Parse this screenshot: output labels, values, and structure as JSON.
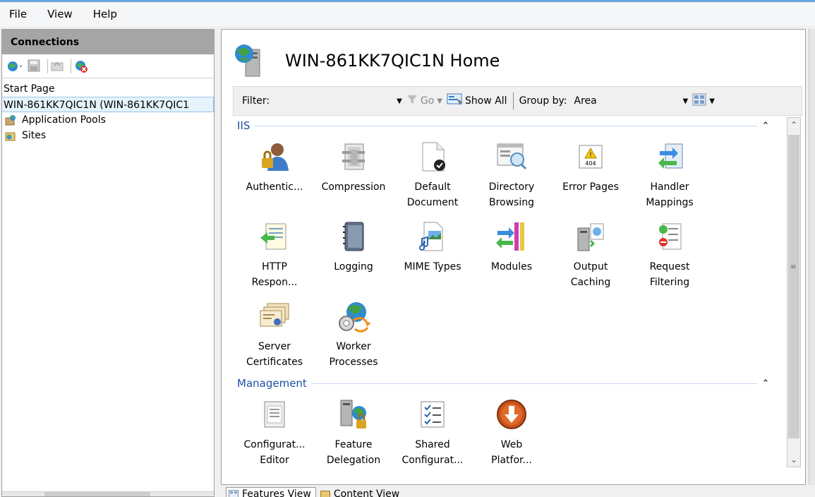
{
  "menu": [
    "File",
    "View",
    "Help"
  ],
  "connections": {
    "title": "Connections",
    "tree": {
      "start_page": "Start Page",
      "server": "WIN-861KK7QIC1N (WIN-861KK7QIC1",
      "children": [
        "Application Pools",
        "Sites"
      ]
    }
  },
  "main": {
    "title": "WIN-861KK7QIC1N Home",
    "filter": {
      "label": "Filter:",
      "value": "",
      "go": "Go",
      "show_all": "Show All",
      "group_by_label": "Group by:",
      "group_by_value": "Area"
    },
    "groups": [
      {
        "name": "IIS",
        "items": [
          {
            "label": "Authentic...",
            "icon": "authentication-icon"
          },
          {
            "label": "Compression",
            "icon": "compression-icon"
          },
          {
            "label": "Default\nDocument",
            "icon": "default-document-icon"
          },
          {
            "label": "Directory\nBrowsing",
            "icon": "directory-browsing-icon"
          },
          {
            "label": "Error Pages",
            "icon": "error-pages-icon"
          },
          {
            "label": "Handler\nMappings",
            "icon": "handler-mappings-icon"
          },
          {
            "label": "HTTP\nRespon...",
            "icon": "http-response-icon"
          },
          {
            "label": "Logging",
            "icon": "logging-icon"
          },
          {
            "label": "MIME Types",
            "icon": "mime-types-icon"
          },
          {
            "label": "Modules",
            "icon": "modules-icon"
          },
          {
            "label": "Output\nCaching",
            "icon": "output-caching-icon"
          },
          {
            "label": "Request\nFiltering",
            "icon": "request-filtering-icon"
          },
          {
            "label": "Server\nCertificates",
            "icon": "server-certificates-icon"
          },
          {
            "label": "Worker\nProcesses",
            "icon": "worker-processes-icon"
          }
        ]
      },
      {
        "name": "Management",
        "items": [
          {
            "label": "Configurat...\nEditor",
            "icon": "configuration-editor-icon"
          },
          {
            "label": "Feature\nDelegation",
            "icon": "feature-delegation-icon"
          },
          {
            "label": "Shared\nConfigurat...",
            "icon": "shared-configuration-icon"
          },
          {
            "label": "Web\nPlatfor...",
            "icon": "web-platform-icon"
          }
        ]
      }
    ]
  },
  "bottom_tabs": [
    "Features View",
    "Content View"
  ],
  "colors": {
    "group_header": "#1e4fa0",
    "selection": "#e5f3fb",
    "conn_header": "#a5a5a5"
  }
}
